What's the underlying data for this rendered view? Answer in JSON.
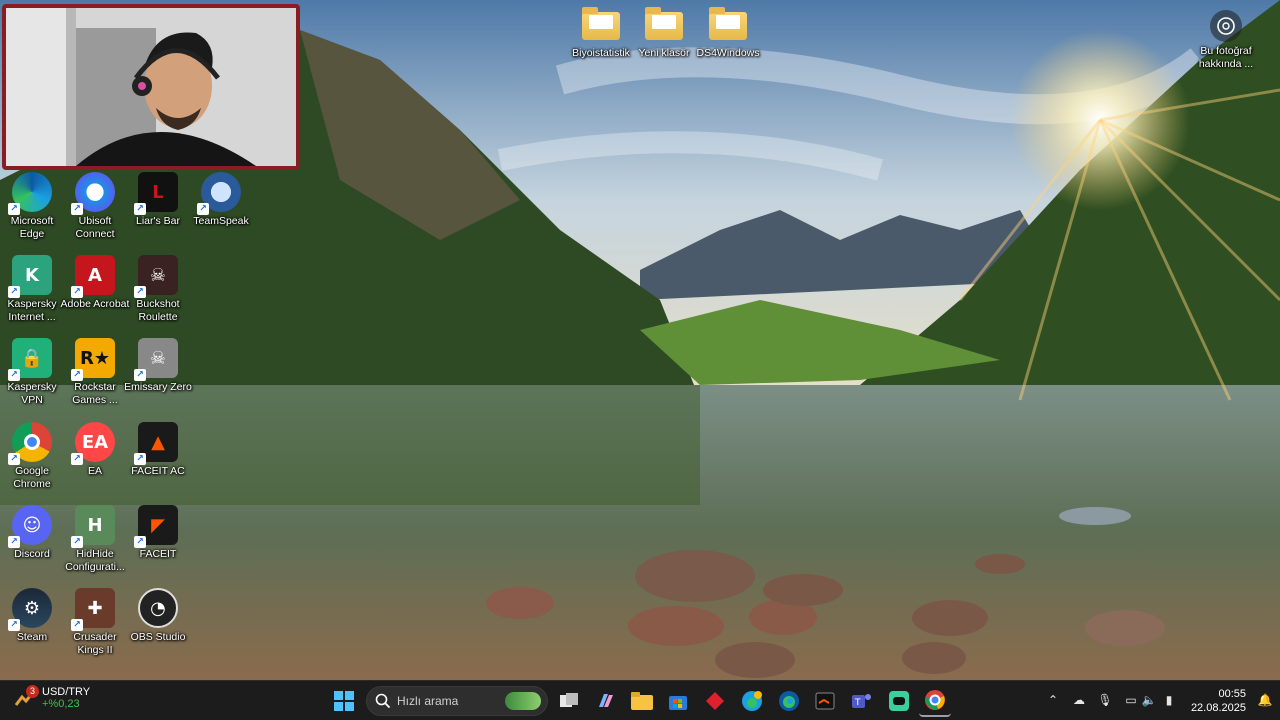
{
  "desktop": {
    "folders": [
      {
        "name": "folder-biyoistatistik",
        "label": "Biyoistatistik"
      },
      {
        "name": "folder-yeni-klasor",
        "label": "Yeni klasör"
      },
      {
        "name": "folder-ds4windows",
        "label": "DS4Windows"
      }
    ],
    "about_photo": {
      "label": "Bu fotoğraf hakkında ..."
    },
    "icons": [
      {
        "label": "Microsoft Edge",
        "icon": "edge-icon",
        "color": "#1a8fd8"
      },
      {
        "label": "Ubisoft Connect",
        "icon": "ubisoft-icon",
        "color": "#1d8fe8"
      },
      {
        "label": "Liar's Bar",
        "icon": "liars-bar-icon",
        "color": "#111111"
      },
      {
        "label": "TeamSpeak",
        "icon": "teamspeak-icon",
        "color": "#2a5a9a"
      },
      {
        "label": "Kaspersky Internet ...",
        "icon": "kaspersky-icon",
        "color": "#2ba37c"
      },
      {
        "label": "Adobe Acrobat",
        "icon": "acrobat-icon",
        "color": "#c4161c"
      },
      {
        "label": "Buckshot Roulette",
        "icon": "buckshot-icon",
        "color": "#3a2222"
      },
      {
        "label": "Kaspersky VPN",
        "icon": "kaspersky-vpn-icon",
        "color": "#21b07a"
      },
      {
        "label": "Rockstar Games ...",
        "icon": "rockstar-icon",
        "color": "#f2a900"
      },
      {
        "label": "Emissary Zero",
        "icon": "emissary-icon",
        "color": "#888888"
      },
      {
        "label": "Google Chrome",
        "icon": "chrome-icon",
        "color": "#ffffff"
      },
      {
        "label": "EA",
        "icon": "ea-icon",
        "color": "#ff4747"
      },
      {
        "label": "FACEIT AC",
        "icon": "faceit-ac-icon",
        "color": "#1a1a1a"
      },
      {
        "label": "Discord",
        "icon": "discord-icon",
        "color": "#5865f2"
      },
      {
        "label": "HidHide Configurati...",
        "icon": "hidhide-icon",
        "color": "#5a8a5a"
      },
      {
        "label": "FACEIT",
        "icon": "faceit-icon",
        "color": "#1a1a1a"
      },
      {
        "label": "Steam",
        "icon": "steam-icon",
        "color": "#1b2838"
      },
      {
        "label": "Crusader Kings II",
        "icon": "crusader-kings-icon",
        "color": "#6a3a2a"
      },
      {
        "label": "OBS Studio",
        "icon": "obs-icon",
        "color": "#222222"
      }
    ]
  },
  "taskbar": {
    "weather": {
      "title": "USD/TRY",
      "change": "+%0,23",
      "badge": "3"
    },
    "search_placeholder": "Hızlı arama",
    "clock": {
      "time": "00:55",
      "date": "22.08.2025"
    }
  }
}
